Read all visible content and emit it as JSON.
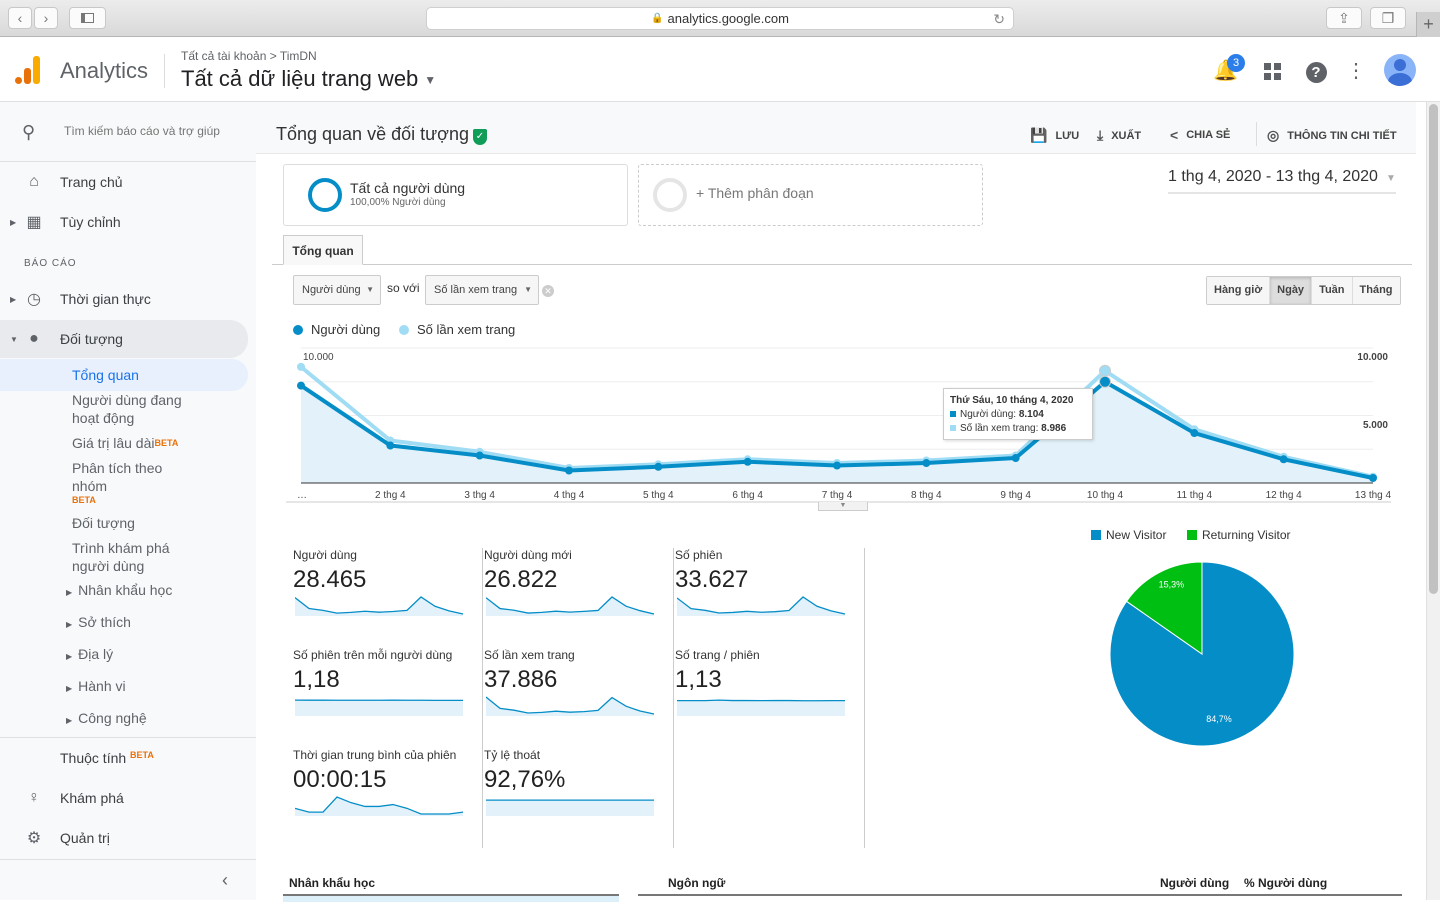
{
  "browser": {
    "url": "analytics.google.com",
    "back_icon": "‹",
    "forward_icon": "›"
  },
  "header": {
    "brand": "Analytics",
    "breadcrumb": "Tất cả tài khoản  >  TimDN",
    "view_name": "Tất cả dữ liệu trang web",
    "notification_count": "3",
    "colors": {
      "logo_orange": "#e8710a",
      "logo_yellow": "#f9ab00",
      "badge": "#2b7de9"
    }
  },
  "sidebar": {
    "search_placeholder": "Tìm kiếm báo cáo và trợ giúp",
    "items": [
      {
        "label": "Trang chủ",
        "icon": "home-icon"
      },
      {
        "label": "Tùy chỉnh",
        "icon": "dashboard-icon"
      }
    ],
    "section_label": "BÁO CÁO",
    "reports": [
      {
        "label": "Thời gian thực",
        "icon": "clock-icon"
      },
      {
        "label": "Đối tượng",
        "icon": "person-icon"
      }
    ],
    "audience_sub": [
      {
        "label": "Tổng quan"
      },
      {
        "label": "Người dùng đang hoạt động"
      },
      {
        "label": "Giá trị lâu dài",
        "badge": "BETA"
      },
      {
        "label": "Phân tích theo nhóm",
        "badge": "BETA"
      },
      {
        "label": "Đối tượng"
      },
      {
        "label": "Trình khám phá người dùng"
      }
    ],
    "audience_groups": [
      "Nhân khẩu học",
      "Sở thích",
      "Địa lý",
      "Hành vi",
      "Công nghệ"
    ],
    "bottom": [
      {
        "label": "Thuộc tính",
        "badge": "BETA"
      },
      {
        "label": "Khám phá",
        "icon": "lightbulb-icon"
      },
      {
        "label": "Quản trị",
        "icon": "gear-icon"
      }
    ]
  },
  "main": {
    "title": "Tổng quan về đối tượng",
    "actions": {
      "save": "LƯU",
      "export": "XUẤT",
      "share": "CHIA SẺ",
      "insights": "THÔNG TIN CHI TIẾT"
    },
    "segment": {
      "name": "Tất cả người dùng",
      "percent": "100,00% Người dùng"
    },
    "add_segment": "+ Thêm phân đoạn",
    "date_range": "1 thg 4, 2020 - 13 thg 4, 2020",
    "tab": "Tổng quan",
    "metric_primary": "Người dùng",
    "compare_label": "so với",
    "metric_secondary": "Số lần xem trang",
    "granularity": [
      "Hàng giờ",
      "Ngày",
      "Tuần",
      "Tháng"
    ],
    "granularity_selected": "Ngày",
    "tooltip": {
      "date": "Thứ Sáu, 10 tháng 4, 2020",
      "users_label": "Người dùng: ",
      "users_value": "8.104",
      "pageviews_label": "Số lần xem trang: ",
      "pageviews_value": "8.986"
    },
    "metrics": [
      {
        "label": "Người dùng",
        "value": "28.465",
        "spark": [
          7.8,
          3.0,
          2.2,
          1.0,
          1.3,
          1.8,
          1.4,
          1.7,
          2.2,
          8.1,
          4.0,
          2.0,
          0.6
        ]
      },
      {
        "label": "Người dùng mới",
        "value": "26.822",
        "spark": [
          7.4,
          2.8,
          2.1,
          0.9,
          1.2,
          1.7,
          1.3,
          1.6,
          2.0,
          7.7,
          3.8,
          1.9,
          0.5
        ]
      },
      {
        "label": "Số phiên",
        "value": "33.627",
        "spark": [
          9.0,
          3.5,
          2.6,
          1.2,
          1.5,
          2.1,
          1.6,
          1.9,
          2.5,
          9.5,
          4.7,
          2.3,
          0.7
        ]
      },
      {
        "label": "Số phiên trên mỗi người dùng",
        "value": "1,18",
        "spark": [
          1.2,
          1.19,
          1.19,
          1.18,
          1.18,
          1.18,
          1.18,
          1.19,
          1.18,
          1.18,
          1.17,
          1.17,
          1.17
        ]
      },
      {
        "label": "Số lần xem trang",
        "value": "37.886",
        "spark": [
          9.3,
          3.6,
          2.7,
          1.3,
          1.6,
          2.2,
          1.7,
          2.0,
          2.6,
          9.0,
          4.7,
          2.3,
          0.8
        ]
      },
      {
        "label": "Số trang / phiên",
        "value": "1,13",
        "spark": [
          1.12,
          1.12,
          1.12,
          1.18,
          1.13,
          1.13,
          1.12,
          1.13,
          1.13,
          1.11,
          1.11,
          1.12,
          1.12
        ]
      },
      {
        "label": "Thời gian trung bình của phiên",
        "value": "00:00:15",
        "spark": [
          14,
          12,
          12,
          20,
          17,
          15,
          15,
          16,
          14,
          11,
          11,
          11,
          12
        ]
      },
      {
        "label": "Tỷ lệ thoát",
        "value": "92,76%",
        "spark": [
          92.8,
          92.8,
          92.8,
          92.8,
          92.8,
          92.8,
          92.8,
          92.8,
          92.9,
          92.9,
          92.9,
          92.9,
          92.9
        ]
      }
    ],
    "tables": {
      "demographics_title": "Nhân khẩu học",
      "language_title": "Ngôn ngữ",
      "col_users": "Người dùng",
      "col_pct_users": "% Người dùng"
    }
  },
  "chart_data": [
    {
      "type": "line",
      "title": "",
      "categories": [
        "…",
        "2 thg 4",
        "3 thg 4",
        "4 thg 4",
        "5 thg 4",
        "6 thg 4",
        "7 thg 4",
        "8 thg 4",
        "9 thg 4",
        "10 thg 4",
        "11 thg 4",
        "12 thg 4",
        "13 thg 4"
      ],
      "series": [
        {
          "name": "Người dùng",
          "color": "#058dc7",
          "values": [
            7800,
            3000,
            2200,
            1000,
            1300,
            1700,
            1400,
            1600,
            2000,
            8104,
            4000,
            1900,
            400
          ],
          "fill": true
        },
        {
          "name": "Số lần xem trang",
          "color": "#a0dcf4",
          "values": [
            9300,
            3400,
            2500,
            1200,
            1500,
            1900,
            1600,
            1800,
            2200,
            8986,
            4300,
            2100,
            500
          ]
        }
      ],
      "y_left_ticks": [
        "10.000",
        "5.000"
      ],
      "y_right_ticks": [
        "10.000",
        "5.000"
      ],
      "ylim": [
        0,
        10000
      ],
      "legend": "top-left",
      "grid": true
    },
    {
      "type": "pie",
      "slices": [
        {
          "name": "New Visitor",
          "value": 84.7,
          "label": "84,7%",
          "color": "#058dc7"
        },
        {
          "name": "Returning Visitor",
          "value": 15.3,
          "label": "15,3%",
          "color": "#00bf13"
        }
      ],
      "legend": "top"
    }
  ]
}
